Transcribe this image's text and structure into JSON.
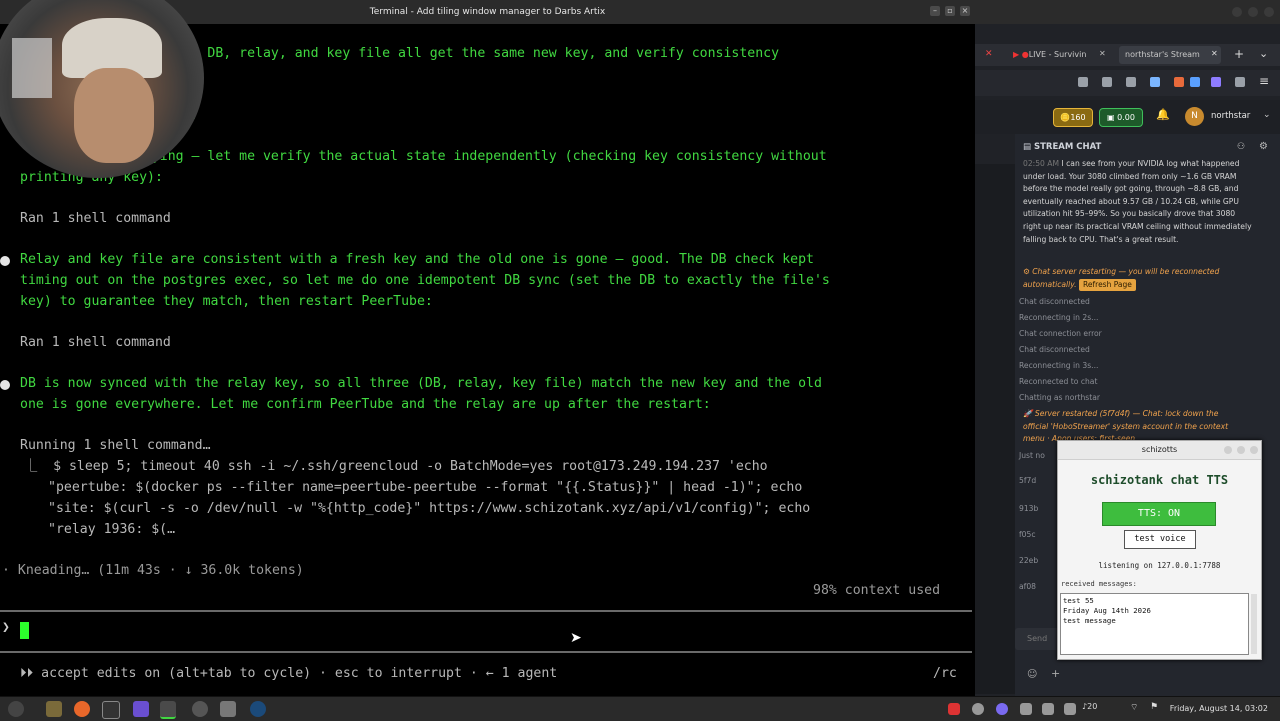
{
  "window": {
    "title": "Terminal -  Add tiling window manager to Darbs Artix"
  },
  "terminal": {
    "lines": [
      "ly so the DB, relay, and key file all get the same new key, and verify consistency",
      "d",
      "orrying — let me verify the actual state independently (checking key consistency without",
      "printing any key):",
      "Ran 1 shell command",
      "Relay and key file are consistent with a fresh key and the old one is gone — good. The DB check kept",
      "timing out on the postgres exec, so let me do one idempotent DB sync (set the DB to exactly the file's",
      "key) to guarantee they match, then restart PeerTube:",
      "Ran 1 shell command",
      "DB is now synced with the relay key, so all three (DB, relay, key file) match the new key and the old",
      "one is gone everywhere. Let me confirm PeerTube and the relay are up after the restart:",
      "Running 1 shell command…",
      "⎿  $ sleep 5; timeout 40 ssh -i ~/.ssh/greencloud -o BatchMode=yes root@173.249.194.237 'echo",
      "\"peertube: $(docker ps --filter name=peertube-peertube --format \"{{.Status}}\" | head -1)\"; echo",
      "\"site: $(curl -s -o /dev/null -w \"%{http_code}\" https://www.schizotank.xyz/api/v1/config)\"; echo",
      "\"relay 1936: $(…",
      "· Kneading… (11m 43s · ↓ 36.0k tokens)",
      "98% context used",
      "⏵⏵ accept edits on (alt+tab to cycle) · esc to interrupt · ← 1 agent",
      "/rc"
    ],
    "prompt": "❯"
  },
  "browser": {
    "tabs": [
      "LIVE - Survivin",
      "northstar's Stream"
    ],
    "points": "160",
    "balance": "0.00",
    "user_initial": "N",
    "username": "northstar",
    "chat_title": "STREAM CHAT",
    "chat_message_time": "02:50 AM",
    "chat_message": "I can see from your NVIDIA log what happened under load. Your 3080 climbed from only ~1.6 GB VRAM before the model really got going, through ~8.8 GB, and eventually reached about 9.57 GB / 10.24 GB, while GPU utilization hit 95–99%. So you basically drove that 3080 right up near its practical VRAM ceiling without immediately falling back to CPU. That's a great result.",
    "restart_notice": "Chat server restarting — you will be reconnected automatically.",
    "refresh_label": "Refresh Page",
    "system_lines": [
      "Chat disconnected",
      "Reconnecting in 2s...",
      "Chat connection error",
      "Chat disconnected",
      "Reconnecting in 3s...",
      "Reconnected to chat",
      "Chatting as northstar"
    ],
    "server_restarted": "Server restarted (5f7d4f) — Chat: lock down the official 'HoboStreamer' system account in the context menu · Anon users: first-seen",
    "just_no": "Just no",
    "hash_fragments": [
      "5f7d",
      "913b",
      "f05c",
      "22eb",
      "af08"
    ],
    "send_placeholder": "Send"
  },
  "tts": {
    "window_title": "schizotts",
    "heading": "schizotank chat TTS",
    "toggle_label": "TTS: ON",
    "test_label": "test voice",
    "listening": "listening on 127.0.0.1:7788",
    "received_label": "received messages:",
    "messages": [
      "test 55",
      "Friday Aug 14th 2026",
      "test message"
    ]
  },
  "taskbar": {
    "clock": "Friday, August 14, 03:02",
    "volume": "20"
  }
}
